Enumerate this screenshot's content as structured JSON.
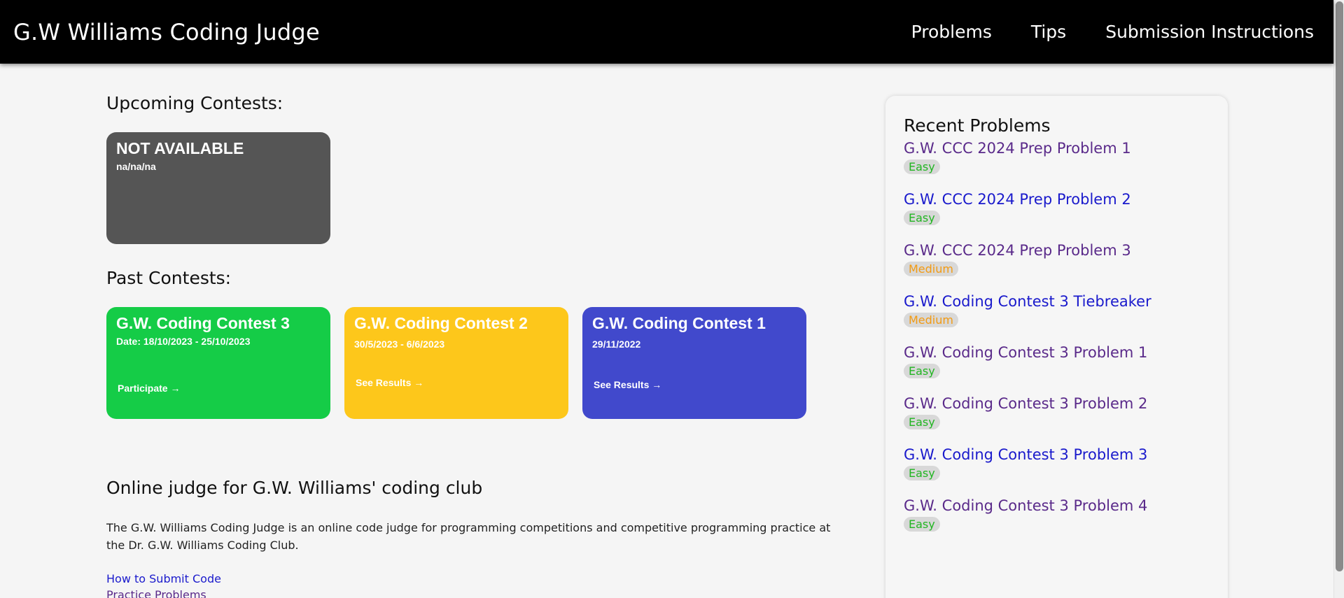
{
  "header": {
    "brand": "G.W Williams Coding Judge",
    "nav": [
      "Problems",
      "Tips",
      "Submission Instructions"
    ]
  },
  "upcoming": {
    "title": "Upcoming Contests:",
    "card": {
      "name": "NOT AVAILABLE",
      "date": "na/na/na",
      "color": "#555555"
    }
  },
  "past": {
    "title": "Past Contests:",
    "cards": [
      {
        "name": "G.W. Coding Contest 3",
        "date": "Date: 18/10/2023 - 25/10/2023",
        "link": "Participate →",
        "color": "#15cc47"
      },
      {
        "name": "G.W. Coding Contest 2",
        "date": "30/5/2023 - 6/6/2023",
        "link": "See Results →",
        "color": "#fdc71b"
      },
      {
        "name": "G.W. Coding Contest 1",
        "date": "29/11/2022",
        "link": "See Results →",
        "color": "#4149cc"
      }
    ]
  },
  "about": {
    "title": "Online judge for G.W. Williams' coding club",
    "text": "The G.W. Williams Coding Judge is an online code judge for programming competitions and competitive programming practice at the Dr. G.W. Williams Coding Club.",
    "links": [
      "How to Submit Code",
      "Practice Problems"
    ]
  },
  "recent": {
    "title": "Recent Problems",
    "items": [
      {
        "name": "G.W. CCC 2024 Prep Problem 1",
        "difficulty": "Easy",
        "visited": true
      },
      {
        "name": "G.W. CCC 2024 Prep Problem 2",
        "difficulty": "Easy",
        "visited": false
      },
      {
        "name": "G.W. CCC 2024 Prep Problem 3",
        "difficulty": "Medium",
        "visited": true
      },
      {
        "name": "G.W. Coding Contest 3 Tiebreaker",
        "difficulty": "Medium",
        "visited": false
      },
      {
        "name": "G.W. Coding Contest 3 Problem 1",
        "difficulty": "Easy",
        "visited": true
      },
      {
        "name": "G.W. Coding Contest 3 Problem 2",
        "difficulty": "Easy",
        "visited": true
      },
      {
        "name": "G.W. Coding Contest 3 Problem 3",
        "difficulty": "Easy",
        "visited": false
      },
      {
        "name": "G.W. Coding Contest 3 Problem 4",
        "difficulty": "Easy",
        "visited": true
      }
    ]
  },
  "colors": {
    "link": "#1a1acc",
    "visited": "#5a2a8a",
    "easy": "#22b522",
    "medium": "#f29a12"
  }
}
